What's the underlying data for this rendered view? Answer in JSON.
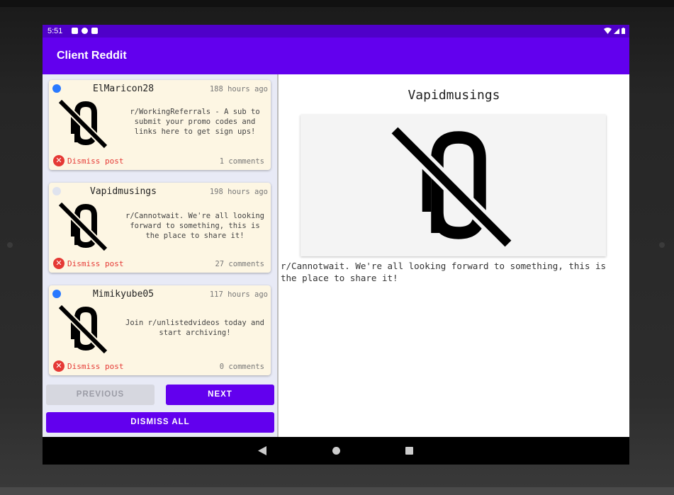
{
  "status_bar": {
    "time": "5:51"
  },
  "app_bar": {
    "title": "Client Reddit"
  },
  "posts": [
    {
      "author": "ElMaricon28",
      "time_ago": "188 hours ago",
      "title": "r/WorkingReferrals - A sub to submit your promo codes and links here to get sign ups!",
      "dismiss_label": "Dismiss post",
      "comments": "1 comments",
      "unread": true
    },
    {
      "author": "Vapidmusings",
      "time_ago": "198 hours ago",
      "title": "r/Cannotwait. We're all looking forward to something, this is the place to share it!",
      "dismiss_label": "Dismiss post",
      "comments": "27 comments",
      "unread": false
    },
    {
      "author": "Mimikyube05",
      "time_ago": "117 hours ago",
      "title": "Join r/unlistedvideos today and start archiving!",
      "dismiss_label": "Dismiss post",
      "comments": "0 comments",
      "unread": true
    }
  ],
  "pagination": {
    "previous_label": "PREVIOUS",
    "next_label": "NEXT",
    "dismiss_all_label": "DISMISS ALL"
  },
  "detail": {
    "author": "Vapidmusings",
    "text": "r/Cannotwait. We're all looking forward to something, this is the place to share it!"
  },
  "colors": {
    "primary": "#6200ee",
    "status_bar": "#4f00c9",
    "unread_dot": "#2979ff",
    "read_dot": "#dfe3ee",
    "dismiss": "#e53935",
    "card_bg": "#fdf6e3"
  },
  "icons": {
    "thumbnail": "no-image-icon",
    "dismiss": "close-circle-icon",
    "nav_back": "back-triangle-icon",
    "nav_home": "home-circle-icon",
    "nav_recents": "recents-square-icon"
  }
}
